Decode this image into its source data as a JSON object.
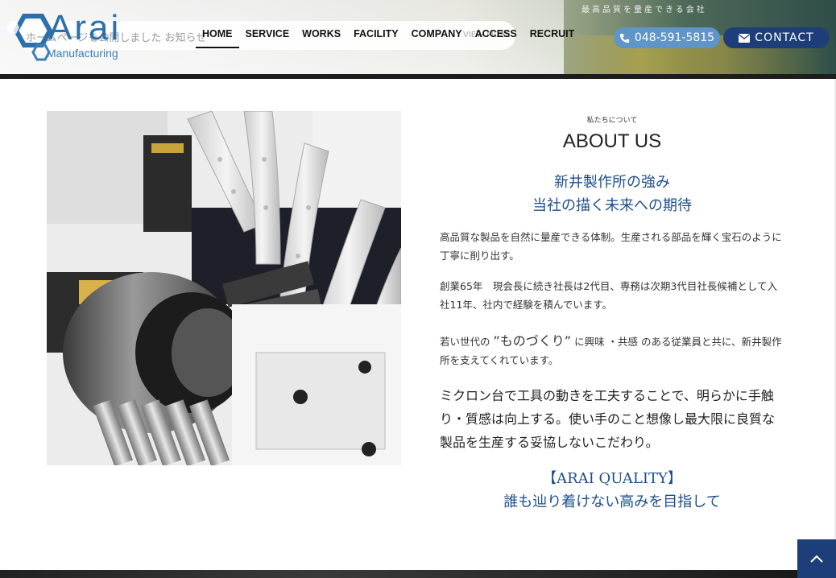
{
  "header": {
    "tagline": "最高品質を量産できる会社",
    "news_text": "ホームページを公開しました お知らせ",
    "news_more": "VIEW MORE",
    "logo_text": "Arai",
    "logo_sub": "Manufacturing",
    "nav": [
      "HOME",
      "SERVICE",
      "WORKS",
      "FACILITY",
      "COMPANY",
      "ACCESS",
      "RECRUIT"
    ],
    "phone": "048-591-5815",
    "contact": "CONTACT"
  },
  "about": {
    "kicker": "私たちについて",
    "heading": "ABOUT US",
    "lead1": "新井製作所の強み",
    "lead2": "当社の描く未来への期待",
    "p1": "高品質な製品を自然に量産できる体制。生産される部品を輝く宝石のように丁寧に削り出す。",
    "p2": "創業65年　現会長に続き社長は2代目、専務は次期3代目社長候補として入社11年、社内で経験を積んでいます。",
    "p3_before": "若い世代の",
    "p3_quote": "”ものづくり”",
    "p3_after": "に興味 ・共感 のある従業員と共に、新井製作所を支えてくれています。",
    "p4": "ミクロン台で工具の動きを工夫することで、明らかに手触り・質感は向上する。使い手のこと想像し最大限に良質な製品を生産する妥協しないこだわり。",
    "quality1": "【ARAI QUALITY】",
    "quality2": "誰も辿り着けない高みを目指して"
  },
  "colors": {
    "brand_blue": "#2b6fab",
    "navy": "#1d3e78",
    "phone_blue": "#5f95c9",
    "accent_text": "#1e4f8b"
  },
  "icons": {
    "phone": "phone-icon",
    "contact": "envelope-icon",
    "pagetop": "chevron-up-icon"
  }
}
